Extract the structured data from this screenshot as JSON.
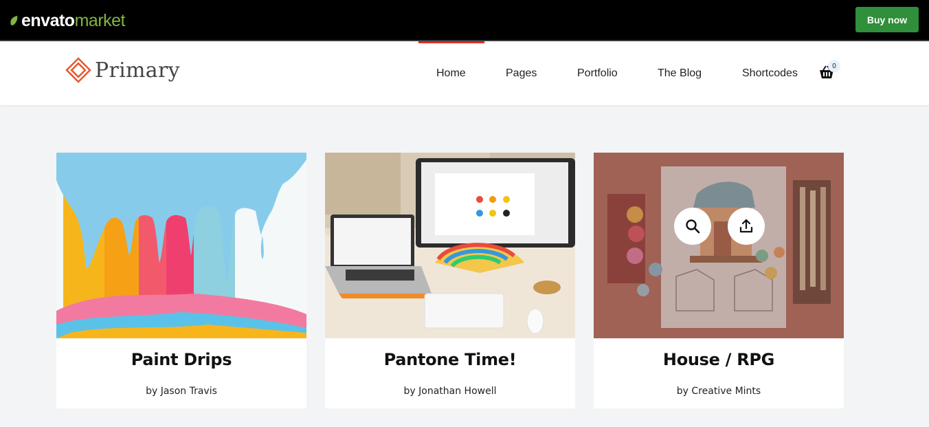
{
  "envato": {
    "logo_word1": "envato",
    "logo_word2": "market",
    "buy_label": "Buy now",
    "buy_color": "#2f8f3a"
  },
  "header": {
    "brand_name": "Primary",
    "nav": [
      {
        "label": "Home",
        "active": true
      },
      {
        "label": "Pages"
      },
      {
        "label": "Portfolio"
      },
      {
        "label": "The Blog"
      },
      {
        "label": "Shortcodes"
      }
    ],
    "cart_count": "0",
    "accent_color": "#e0302d"
  },
  "portfolio": {
    "items": [
      {
        "title": "Paint Drips",
        "author": "by Jason Travis",
        "icon": "image"
      },
      {
        "title": "Pantone Time!",
        "author": "by Jonathan Howell",
        "icon": "image"
      },
      {
        "title": "House / RPG",
        "author": "by Creative Mints",
        "icon": "image",
        "overlay_actions": [
          "search-icon",
          "share-icon"
        ]
      }
    ]
  }
}
